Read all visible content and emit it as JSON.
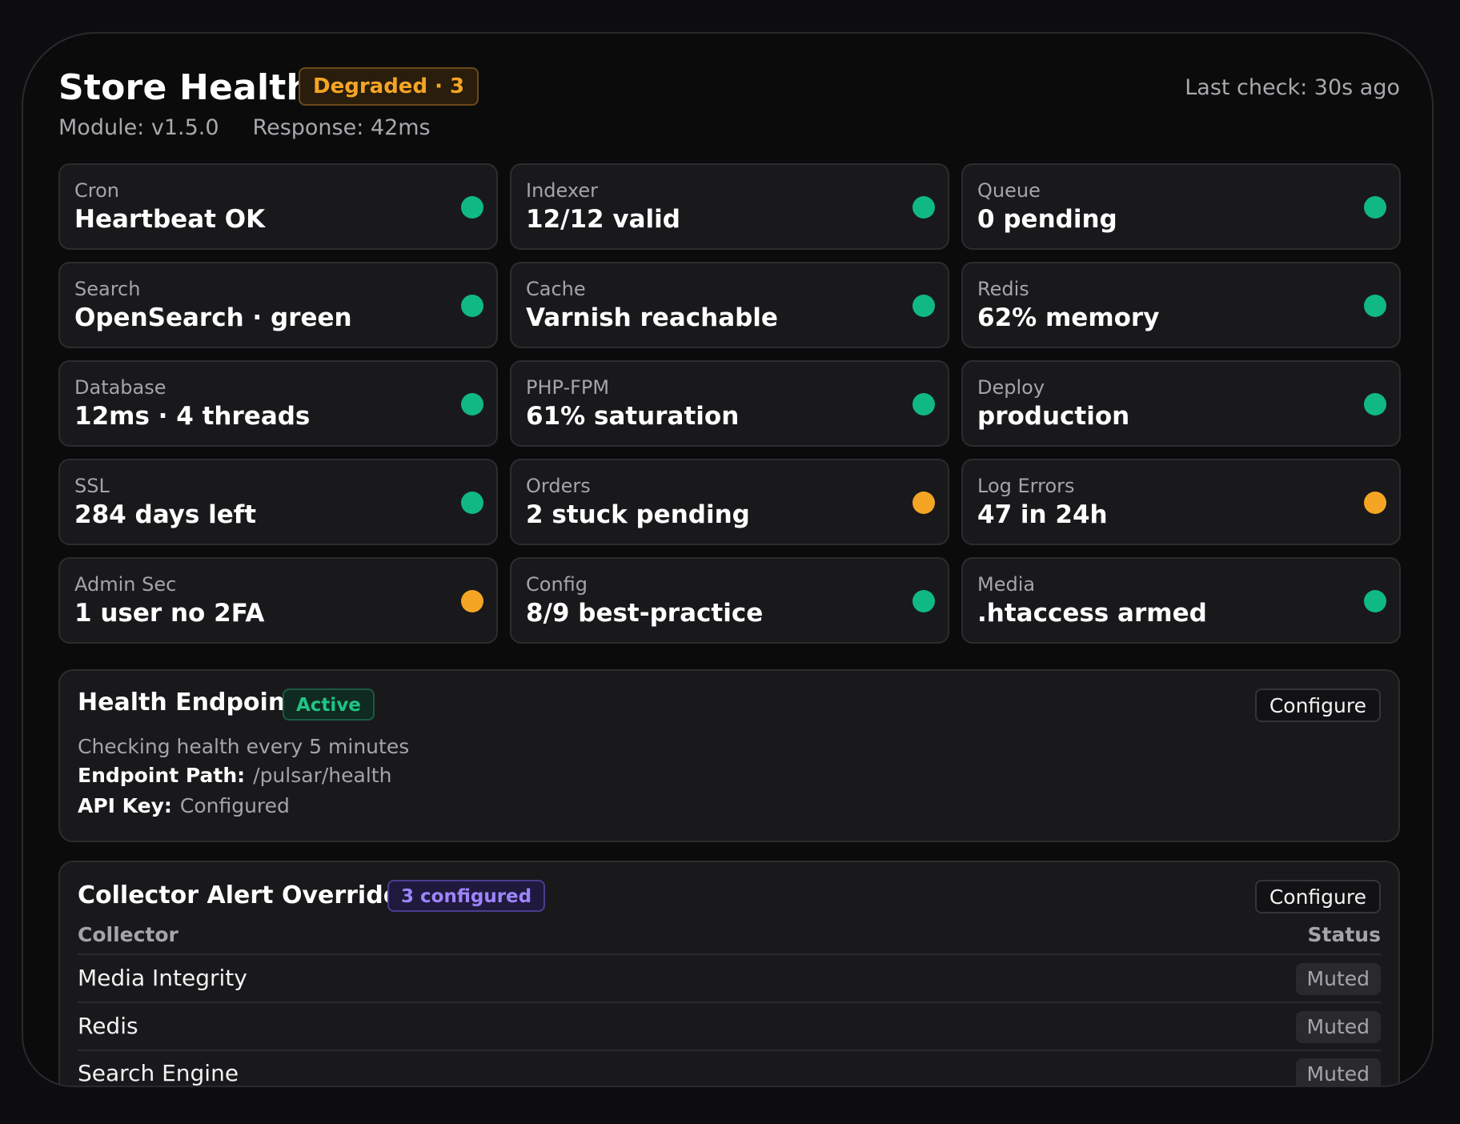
{
  "header": {
    "title": "Store Health",
    "status_badge": "Degraded · 3",
    "last_check": "Last check: 30s ago",
    "module": "Module: v1.5.0",
    "response": "Response: 42ms"
  },
  "colors": {
    "ok": "#10b981",
    "warn": "#f5a524",
    "active": "#20c485",
    "configured": "#9d85ff"
  },
  "checks": [
    {
      "label": "Cron",
      "value": "Heartbeat OK",
      "status": "ok"
    },
    {
      "label": "Indexer",
      "value": "12/12 valid",
      "status": "ok"
    },
    {
      "label": "Queue",
      "value": "0 pending",
      "status": "ok"
    },
    {
      "label": "Search",
      "value": "OpenSearch · green",
      "status": "ok"
    },
    {
      "label": "Cache",
      "value": "Varnish reachable",
      "status": "ok"
    },
    {
      "label": "Redis",
      "value": "62% memory",
      "status": "ok"
    },
    {
      "label": "Database",
      "value": "12ms · 4 threads",
      "status": "ok"
    },
    {
      "label": "PHP-FPM",
      "value": "61% saturation",
      "status": "ok"
    },
    {
      "label": "Deploy",
      "value": "production",
      "status": "ok"
    },
    {
      "label": "SSL",
      "value": "284 days left",
      "status": "ok"
    },
    {
      "label": "Orders",
      "value": "2 stuck pending",
      "status": "warn"
    },
    {
      "label": "Log Errors",
      "value": "47 in 24h",
      "status": "warn"
    },
    {
      "label": "Admin Sec",
      "value": "1 user no 2FA",
      "status": "warn"
    },
    {
      "label": "Config",
      "value": "8/9 best-practice",
      "status": "ok"
    },
    {
      "label": "Media",
      "value": ".htaccess armed",
      "status": "ok"
    }
  ],
  "health_endpoint": {
    "title": "Health Endpoint",
    "badge": "Active",
    "configure_label": "Configure",
    "description": "Checking health every 5 minutes",
    "path_label": "Endpoint Path:",
    "path_value": "/pulsar/health",
    "api_key_label": "API Key:",
    "api_key_value": "Configured"
  },
  "collector_overrides": {
    "title": "Collector Alert Overrides",
    "badge": "3 configured",
    "configure_label": "Configure",
    "columns": [
      "Collector",
      "Status"
    ],
    "rows": [
      {
        "collector": "Media Integrity",
        "status": "Muted"
      },
      {
        "collector": "Redis",
        "status": "Muted"
      },
      {
        "collector": "Search Engine",
        "status": "Muted"
      }
    ]
  }
}
